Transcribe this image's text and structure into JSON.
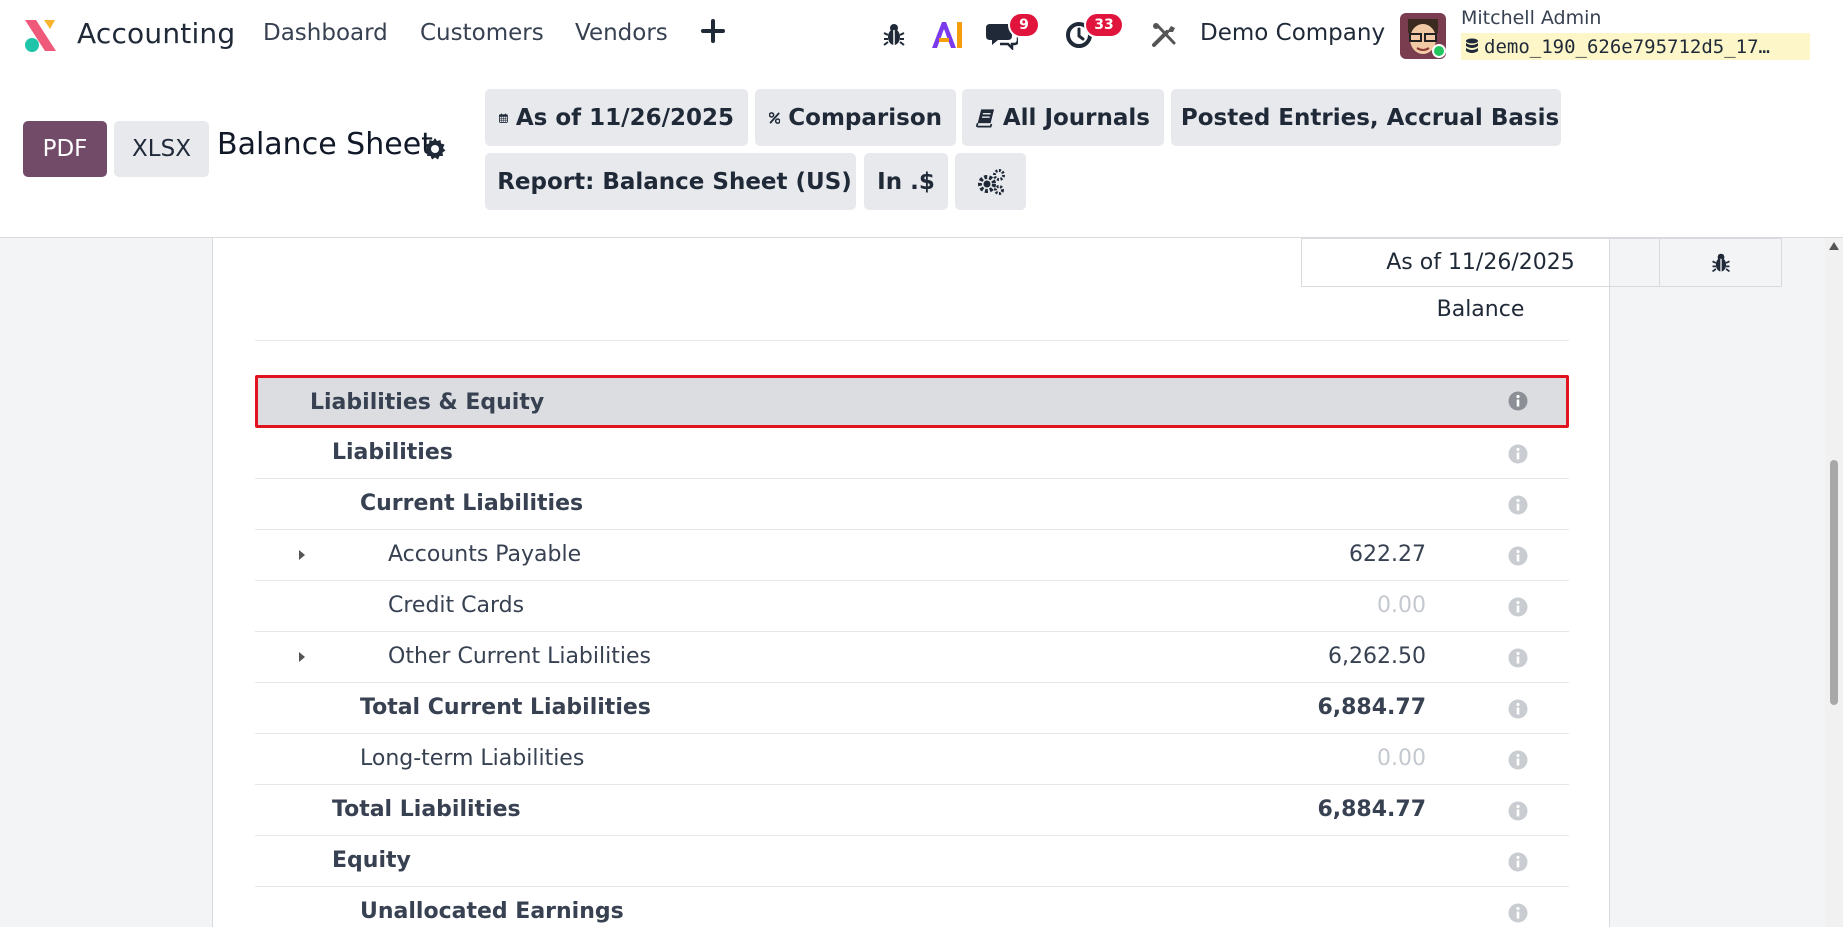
{
  "nav": {
    "app_name": "Accounting",
    "menu": [
      "Dashboard",
      "Customers",
      "Vendors"
    ],
    "messages_count": "9",
    "activities_count": "33",
    "company": "Demo Company",
    "user_name": "Mitchell Admin",
    "db_name": "demo_190_626e795712d5_17…"
  },
  "toolbar": {
    "pdf_label": "PDF",
    "xlsx_label": "XLSX",
    "title": "Balance Sheet",
    "filters": {
      "date": "As of 11/26/2025",
      "comparison": "Comparison",
      "journals": "All Journals",
      "options": "Posted Entries, Accrual Basis",
      "report": "Report: Balance Sheet (US)",
      "currency": "In .$"
    }
  },
  "report": {
    "column_header": "As of 11/26/2025",
    "column_sub": "Balance",
    "rows": [
      {
        "label": "Liabilities & Equity",
        "amount": "",
        "level": 1,
        "bold": true,
        "highlight": true,
        "caret": false
      },
      {
        "label": "Liabilities",
        "amount": "",
        "level": 2,
        "bold": true,
        "caret": false
      },
      {
        "label": "Current Liabilities",
        "amount": "",
        "level": 3,
        "bold": true,
        "caret": false
      },
      {
        "label": "Accounts Payable",
        "amount": "622.27",
        "level": 4,
        "bold": false,
        "caret": true
      },
      {
        "label": "Credit Cards",
        "amount": "0.00",
        "level": 4,
        "bold": false,
        "caret": false,
        "muted": true
      },
      {
        "label": "Other Current Liabilities",
        "amount": "6,262.50",
        "level": 4,
        "bold": false,
        "caret": true
      },
      {
        "label": "Total Current Liabilities",
        "amount": "6,884.77",
        "level": 3,
        "bold": true,
        "caret": false
      },
      {
        "label": "Long-term Liabilities",
        "amount": "0.00",
        "level": 3,
        "bold": false,
        "caret": false,
        "muted": true
      },
      {
        "label": "Total Liabilities",
        "amount": "6,884.77",
        "level": 2,
        "bold": true,
        "caret": false
      },
      {
        "label": "Equity",
        "amount": "",
        "level": 2,
        "bold": true,
        "caret": false
      },
      {
        "label": "Unallocated Earnings",
        "amount": "",
        "level": 3,
        "bold": true,
        "caret": false
      }
    ]
  },
  "colors": {
    "brand": "#714b67",
    "badge": "#e0143c",
    "highlight_border": "#e0141f"
  },
  "icons": [
    "app-logo-icon",
    "plus-icon",
    "bug-icon",
    "ai-icon",
    "chat-icon",
    "clock-icon",
    "tools-icon",
    "database-icon",
    "gear-icon",
    "calendar-icon",
    "percent-icon",
    "book-icon",
    "sliders-icon",
    "cogs-icon",
    "caret-right-icon",
    "info-icon"
  ]
}
